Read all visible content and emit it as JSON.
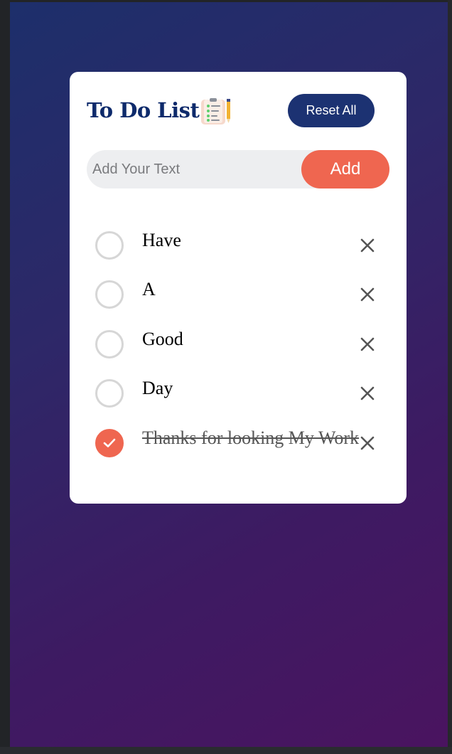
{
  "app": {
    "title": "To Do List",
    "title_icon": "checklist-notepad-pencil-icon"
  },
  "toolbar": {
    "reset_label": "Reset All"
  },
  "input": {
    "placeholder": "Add Your Text",
    "value": "",
    "add_label": "Add"
  },
  "tasks": [
    {
      "text": "Have",
      "done": false
    },
    {
      "text": "A",
      "done": false
    },
    {
      "text": "Good",
      "done": false
    },
    {
      "text": "Day",
      "done": false
    },
    {
      "text": "Thanks for looking My Work",
      "done": true
    }
  ],
  "icons": {
    "checkbox": "circle-checkbox-icon",
    "checked": "checkmark-icon",
    "delete": "close-icon"
  },
  "colors": {
    "accent": "#ef6650",
    "title": "#0d2a6b",
    "reset_button": "#1c3272",
    "gradient_start": "#1d2f6b",
    "gradient_end": "#4a1460"
  }
}
